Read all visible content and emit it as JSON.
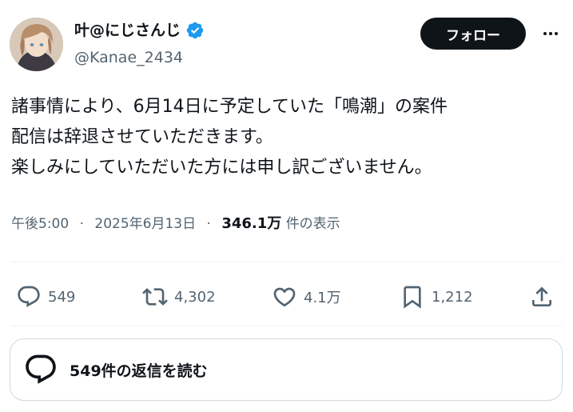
{
  "author": {
    "display_name": "叶@にじさんじ",
    "handle": "@Kanae_2434",
    "verified": true
  },
  "header": {
    "follow_label": "フォロー"
  },
  "tweet": {
    "lines": [
      "諸事情により、6月14日に予定していた「鳴潮」の案件",
      "配信は辞退させていただきます。",
      "楽しみにしていただいた方には申し訳ございません。"
    ],
    "time": "午後5:00",
    "date": "2025年6月13日",
    "views_count": "346.1万",
    "views_label": "件の表示"
  },
  "actions": {
    "replies": "549",
    "retweets": "4,302",
    "likes": "4.1万",
    "bookmarks": "1,212"
  },
  "reply_prompt": "549件の返信を読む",
  "colors": {
    "verified": "#1d9bf0",
    "text_primary": "#0f1419",
    "text_secondary": "#536471",
    "follow_bg": "#0f1419"
  }
}
